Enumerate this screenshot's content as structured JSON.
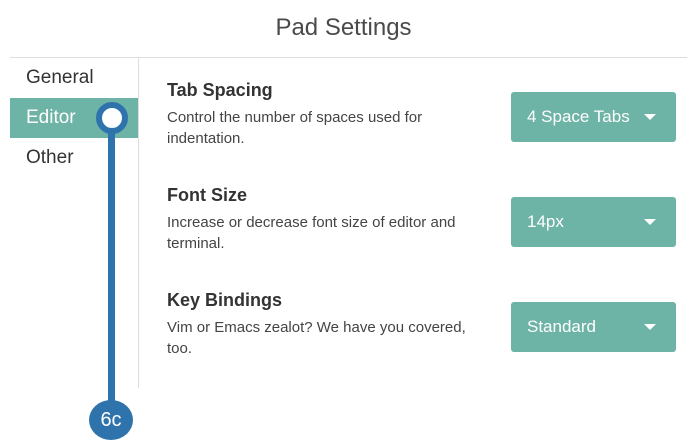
{
  "window": {
    "title": "Pad Settings"
  },
  "sidebar": {
    "items": [
      {
        "label": "General"
      },
      {
        "label": "Editor"
      },
      {
        "label": "Other"
      }
    ],
    "active_index": 1
  },
  "settings": [
    {
      "title": "Tab Spacing",
      "description": "Control the number of spaces used for indentation.",
      "value": "4 Space Tabs"
    },
    {
      "title": "Font Size",
      "description": "Increase or decrease font size of editor and terminal.",
      "value": "14px"
    },
    {
      "title": "Key Bindings",
      "description": "Vim or Emacs zealot? We have you covered, too.",
      "value": "Standard"
    }
  ],
  "callout": {
    "label": "6c",
    "color": "#2f73ad"
  },
  "colors": {
    "accent": "#6db3a6",
    "text": "#333333"
  }
}
